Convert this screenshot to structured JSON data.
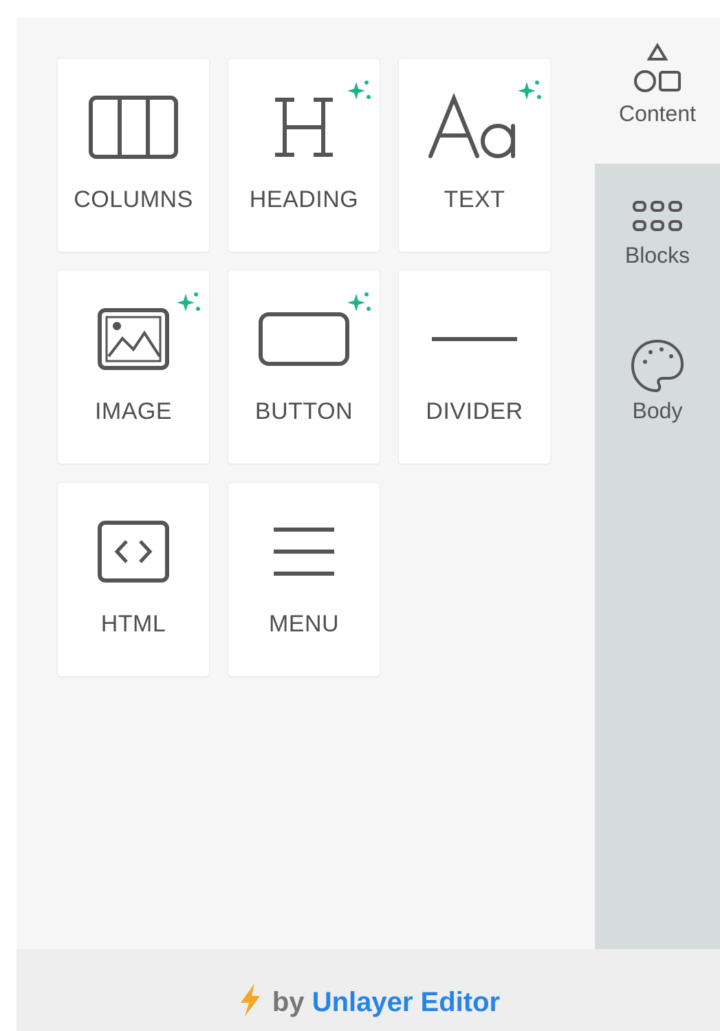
{
  "tiles": [
    {
      "label": "COLUMNS",
      "icon": "columns-icon",
      "ai": false
    },
    {
      "label": "HEADING",
      "icon": "heading-icon",
      "ai": true
    },
    {
      "label": "TEXT",
      "icon": "text-icon",
      "ai": true
    },
    {
      "label": "IMAGE",
      "icon": "image-icon",
      "ai": true
    },
    {
      "label": "BUTTON",
      "icon": "button-icon",
      "ai": true
    },
    {
      "label": "DIVIDER",
      "icon": "divider-icon",
      "ai": false
    },
    {
      "label": "HTML",
      "icon": "html-icon",
      "ai": false
    },
    {
      "label": "MENU",
      "icon": "menu-icon",
      "ai": false
    }
  ],
  "sidebar": {
    "tabs": [
      {
        "label": "Content",
        "icon": "shapes-icon",
        "active": true
      },
      {
        "label": "Blocks",
        "icon": "blocks-grid-icon",
        "active": false
      },
      {
        "label": "Body",
        "icon": "palette-icon",
        "active": false
      }
    ]
  },
  "footer": {
    "by": "by",
    "brand": "Unlayer Editor",
    "icon": "lightning-icon"
  },
  "colors": {
    "accent": "#1db48a",
    "brand": "#2684e6",
    "bolt": "#f5a623",
    "sidebar": "#d6dbdc"
  }
}
